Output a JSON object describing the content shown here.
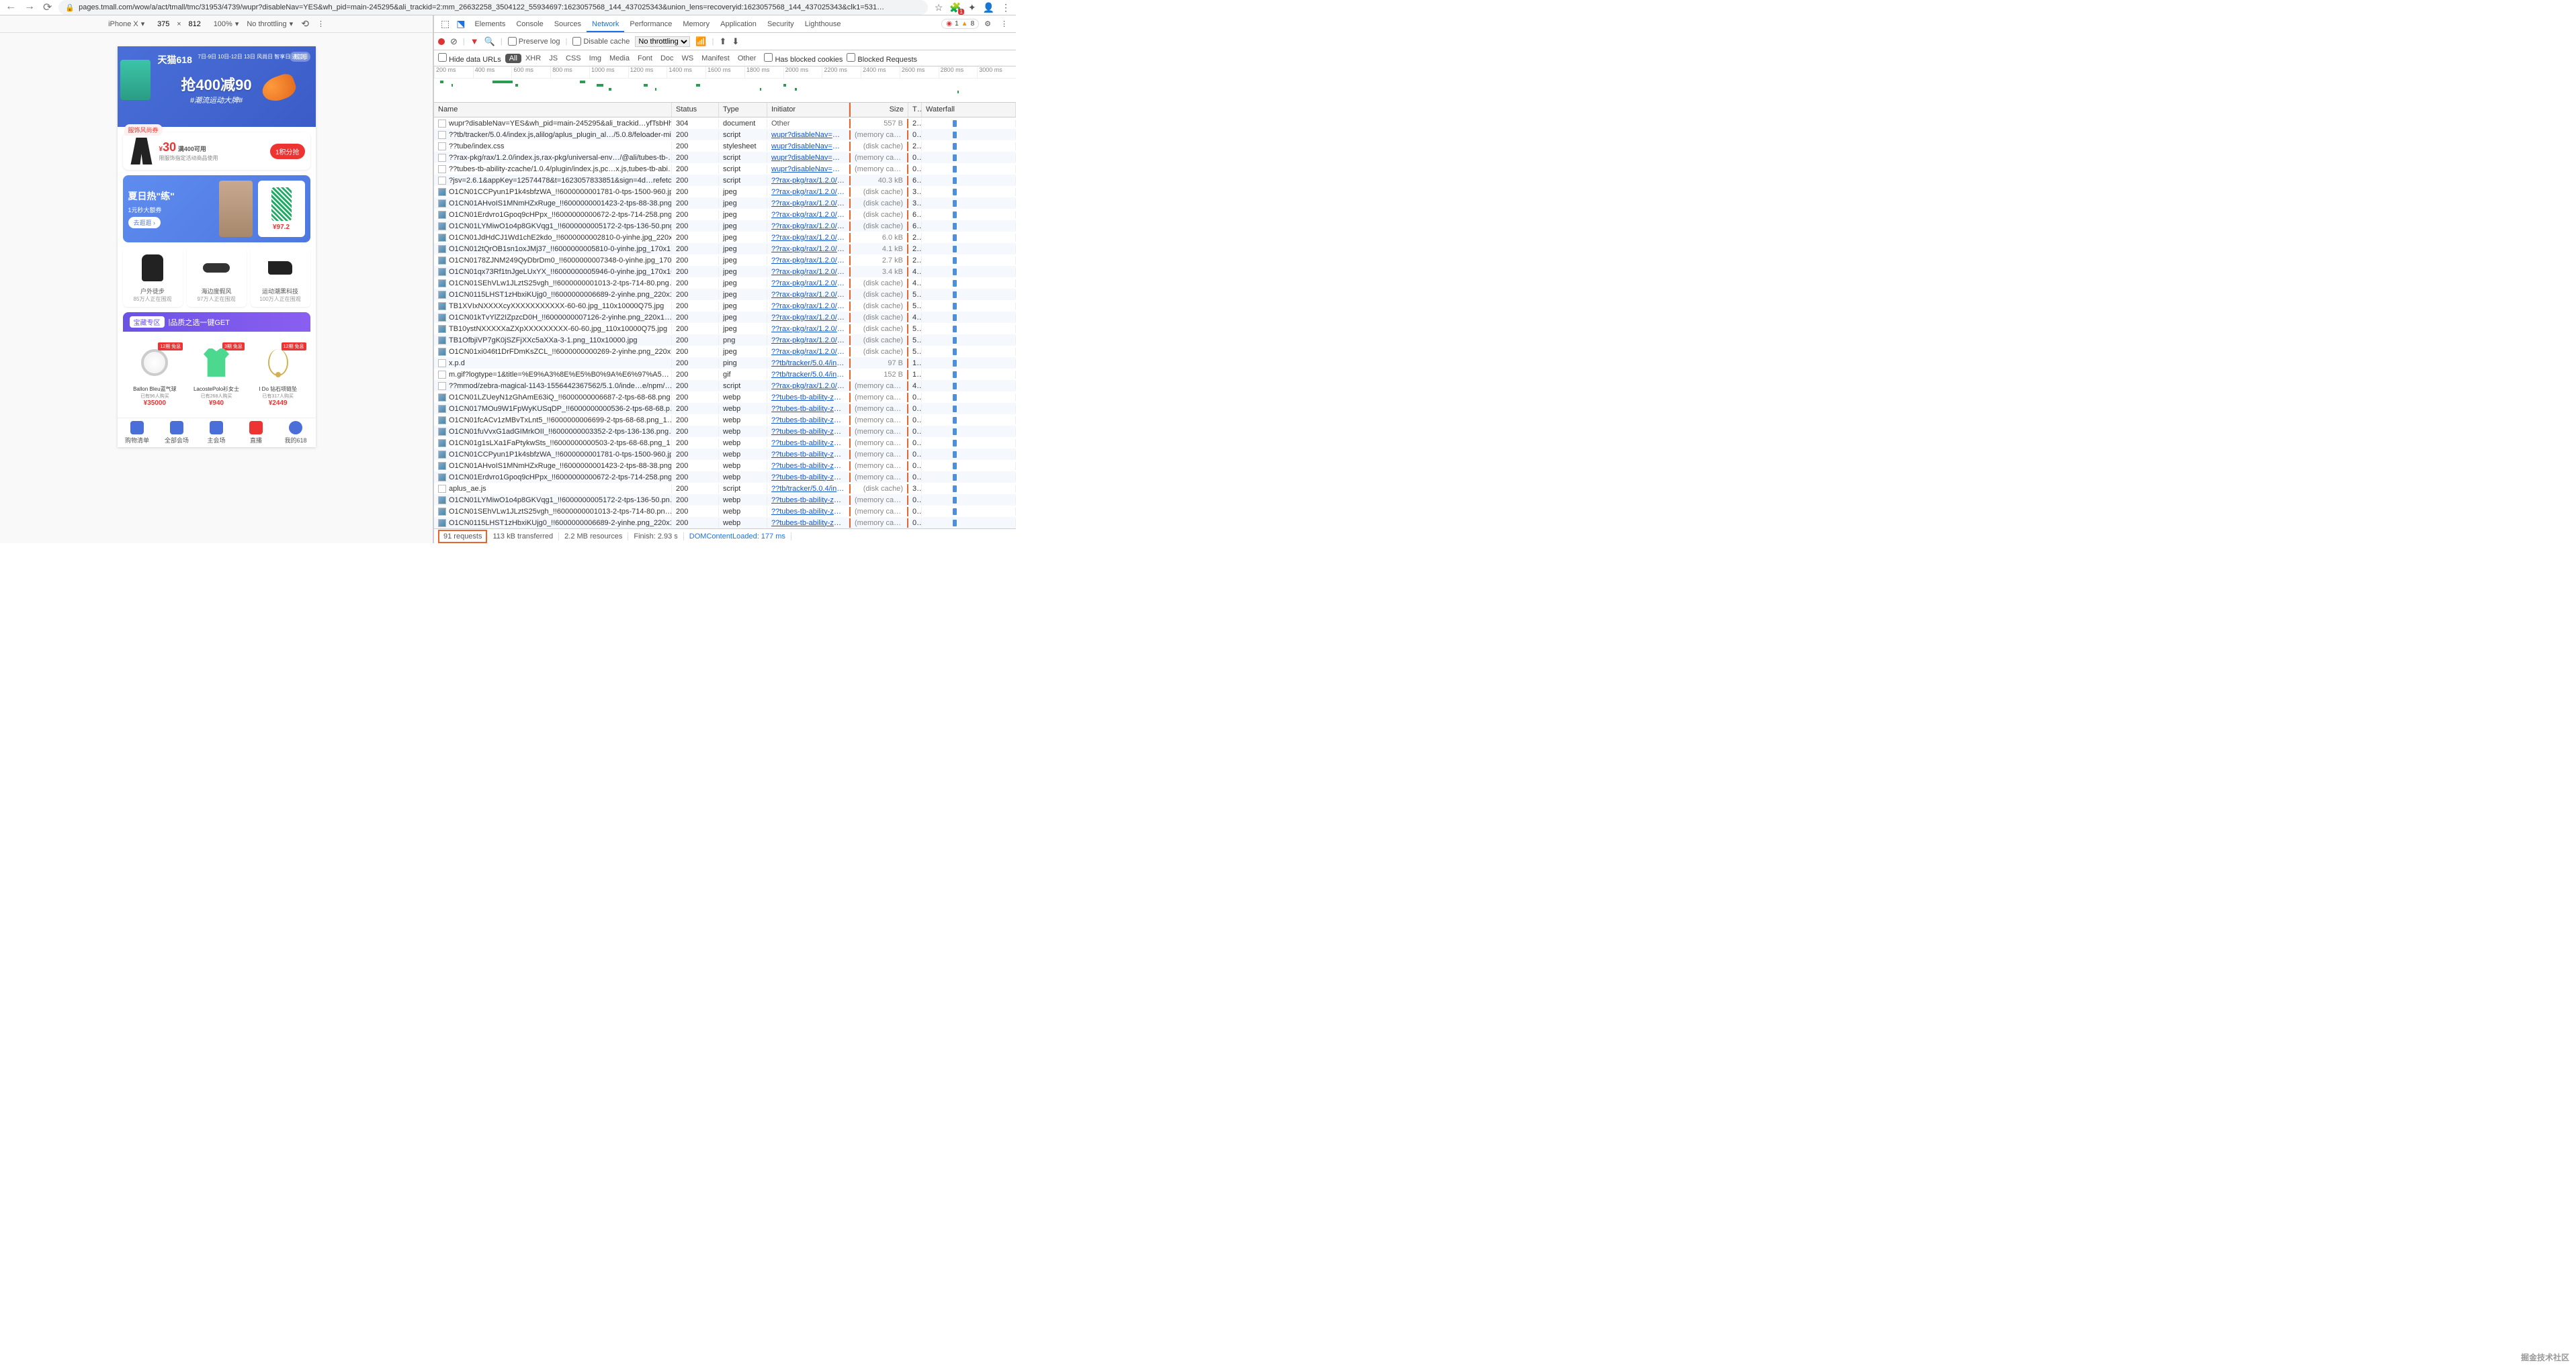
{
  "chrome": {
    "url": "pages.tmall.com/wow/a/act/tmall/tmc/31953/4739/wupr?disableNav=YES&wh_pid=main-245295&ali_trackid=2:mm_26632258_3504122_55934697:1623057568_144_437025343&union_lens=recoveryid:1623057568_144_437025343&clk1=531…",
    "ext_badge": "1"
  },
  "device_bar": {
    "device": "iPhone X",
    "width": "375",
    "height": "812",
    "zoom": "100%",
    "throttle": "No throttling"
  },
  "phone": {
    "banner": {
      "logo": "天猫618",
      "dates": "7日-9日 10日-12日 13日\n风尚日 智享日 进口日",
      "rule": "规则",
      "big": "抢400减90",
      "sub": "#潮流运动大牌#"
    },
    "coupon": {
      "tag": "服饰风尚券",
      "yen": "¥",
      "amt": "30",
      "cond": "满400可用",
      "desc": "限服饰指定活动商品使用",
      "btn": "1积分抢"
    },
    "summer": {
      "title": "夏日热\"练\"",
      "sub": "1元秒大额券",
      "go": "去逛逛 ›",
      "price": "¥97.2"
    },
    "cats": [
      {
        "t1": "户外徒步",
        "t2": "85万人正在围观"
      },
      {
        "t1": "海边度假风",
        "t2": "97万人正在围观"
      },
      {
        "t1": "运动潮黑科技",
        "t2": "100万人正在围观"
      }
    ],
    "treasure": {
      "pill": "宝藏专区",
      "text": "品质之选一键GET"
    },
    "products": [
      {
        "badge": "12期\n免息",
        "name": "Ballon Bleu蓝气球",
        "sold": "已有96人购买",
        "price": "¥35000"
      },
      {
        "badge": "3期\n免息",
        "name": "LacostePolo衫女士",
        "sold": "已有268人购买",
        "price": "¥940"
      },
      {
        "badge": "12期\n免息",
        "name": "I Do 钻石项链坠",
        "sold": "已有317人购买",
        "price": "¥2449"
      }
    ],
    "tabs": [
      "购物清单",
      "全部会场",
      "主会场",
      "直播",
      "我的618"
    ]
  },
  "devtools": {
    "tabs": [
      "Elements",
      "Console",
      "Sources",
      "Network",
      "Performance",
      "Memory",
      "Application",
      "Security",
      "Lighthouse"
    ],
    "active_tab": "Network",
    "errors": "1",
    "warnings": "8",
    "toolbar": {
      "preserve": "Preserve log",
      "disable_cache": "Disable cache",
      "throttle": "No throttling"
    },
    "filter": {
      "hide": "Hide data URLs",
      "types": [
        "All",
        "XHR",
        "JS",
        "CSS",
        "Img",
        "Media",
        "Font",
        "Doc",
        "WS",
        "Manifest",
        "Other"
      ],
      "blocked_cookies": "Has blocked cookies",
      "blocked_req": "Blocked Requests"
    },
    "ticks": [
      "200 ms",
      "400 ms",
      "600 ms",
      "800 ms",
      "1000 ms",
      "1200 ms",
      "1400 ms",
      "1600 ms",
      "1800 ms",
      "2000 ms",
      "2200 ms",
      "2400 ms",
      "2600 ms",
      "2800 ms",
      "3000 ms"
    ],
    "columns": {
      "name": "Name",
      "status": "Status",
      "type": "Type",
      "initiator": "Initiator",
      "size": "Size",
      "time": "T…",
      "waterfall": "Waterfall"
    },
    "rows": [
      {
        "ic": "doc",
        "name": "wupr?disableNav=YES&wh_pid=main-245295&ali_trackid…yfTsbHh…",
        "status": "304",
        "type": "document",
        "init": "Other",
        "initplain": true,
        "size": "557 B",
        "time": "2…"
      },
      {
        "ic": "doc",
        "name": "??tb/tracker/5.0.4/index.js,alilog/aplus_plugin_al…/5.0.8/feloader-mi…",
        "status": "200",
        "type": "script",
        "init": "wupr?disableNav=YES&w…",
        "size": "(memory cache)",
        "time": "0…"
      },
      {
        "ic": "doc",
        "name": "??tube/index.css",
        "status": "200",
        "type": "stylesheet",
        "init": "wupr?disableNav=YES&w…",
        "size": "(disk cache)",
        "time": "2…"
      },
      {
        "ic": "doc",
        "name": "??rax-pkg/rax/1.2.0/index.js,rax-pkg/universal-env…/@ali/tubes-tb-…",
        "status": "200",
        "type": "script",
        "init": "wupr?disableNav=YES&w…",
        "size": "(memory cache)",
        "time": "0…"
      },
      {
        "ic": "doc",
        "name": "??tubes-tb-ability-zcache/1.0.4/plugin/index.js,pc…x.js,tubes-tb-abi…",
        "status": "200",
        "type": "script",
        "init": "wupr?disableNav=YES&w…",
        "size": "(memory cache)",
        "time": "0…"
      },
      {
        "ic": "doc",
        "name": "?jsv=2.6.1&appKey=12574478&t=1623057833851&sign=4d…refetc…",
        "status": "200",
        "type": "script",
        "init": "??rax-pkg/rax/1.2.0/index…",
        "size": "40.3 kB",
        "time": "6…"
      },
      {
        "ic": "img",
        "name": "O1CN01CCPyun1P1k4sbfzWA_!!6000000001781-0-tps-1500-960.jp…",
        "status": "200",
        "type": "jpeg",
        "init": "??rax-pkg/rax/1.2.0/index…",
        "size": "(disk cache)",
        "time": "3…"
      },
      {
        "ic": "img",
        "name": "O1CN01AHvoIS1MNmHZxRuge_!!6000000001423-2-tps-88-38.png…",
        "status": "200",
        "type": "jpeg",
        "init": "??rax-pkg/rax/1.2.0/index…",
        "size": "(disk cache)",
        "time": "3…"
      },
      {
        "ic": "img",
        "name": "O1CN01Erdvro1Gpoq9cHPpx_!!6000000000672-2-tps-714-258.png…",
        "status": "200",
        "type": "jpeg",
        "init": "??rax-pkg/rax/1.2.0/index…",
        "size": "(disk cache)",
        "time": "6…"
      },
      {
        "ic": "img",
        "name": "O1CN01LYMiwO1o4p8GKVqg1_!!6000000005172-2-tps-136-50.png…",
        "status": "200",
        "type": "jpeg",
        "init": "??rax-pkg/rax/1.2.0/index…",
        "size": "(disk cache)",
        "time": "6…"
      },
      {
        "ic": "img",
        "name": "O1CN01JdHdCJ1Wd1chE2kdo_!!6000000002810-0-yinhe.jpg_220x…",
        "status": "200",
        "type": "jpeg",
        "init": "??rax-pkg/rax/1.2.0/index…",
        "size": "6.0 kB",
        "time": "2…"
      },
      {
        "ic": "img",
        "name": "O1CN012tQrOB1sn1oxJMj37_!!6000000005810-0-yinhe.jpg_170x1…",
        "status": "200",
        "type": "jpeg",
        "init": "??rax-pkg/rax/1.2.0/index…",
        "size": "4.1 kB",
        "time": "2…"
      },
      {
        "ic": "img",
        "name": "O1CN0178ZJNM249QyDbrDm0_!!6000000007348-0-yinhe.jpg_170x…",
        "status": "200",
        "type": "jpeg",
        "init": "??rax-pkg/rax/1.2.0/index…",
        "size": "2.7 kB",
        "time": "2…"
      },
      {
        "ic": "img",
        "name": "O1CN01qx73Rf1tnJgeLUxYX_!!6000000005946-0-yinhe.jpg_170x10…",
        "status": "200",
        "type": "jpeg",
        "init": "??rax-pkg/rax/1.2.0/index…",
        "size": "3.4 kB",
        "time": "4…"
      },
      {
        "ic": "img",
        "name": "O1CN01SEhVLw1JLztS25vgh_!!6000000001013-2-tps-714-80.png…",
        "status": "200",
        "type": "jpeg",
        "init": "??rax-pkg/rax/1.2.0/index…",
        "size": "(disk cache)",
        "time": "4…"
      },
      {
        "ic": "img",
        "name": "O1CN0115LHST1zHbxiKUjg0_!!6000000006689-2-yinhe.png_220x1…",
        "status": "200",
        "type": "jpeg",
        "init": "??rax-pkg/rax/1.2.0/index…",
        "size": "(disk cache)",
        "time": "5…"
      },
      {
        "ic": "img",
        "name": "TB1XVIxNXXXXcyXXXXXXXXXXX-60-60.jpg_110x10000Q75.jpg",
        "status": "200",
        "type": "jpeg",
        "init": "??rax-pkg/rax/1.2.0/index…",
        "size": "(disk cache)",
        "time": "5…"
      },
      {
        "ic": "img",
        "name": "O1CN01kTvYlZ2IZpzcD0H_!!6000000007126-2-yinhe.png_220x1…",
        "status": "200",
        "type": "jpeg",
        "init": "??rax-pkg/rax/1.2.0/index…",
        "size": "(disk cache)",
        "time": "4…"
      },
      {
        "ic": "img",
        "name": "TB10ystNXXXXXaZXpXXXXXXXXX-60-60.jpg_110x10000Q75.jpg",
        "status": "200",
        "type": "jpeg",
        "init": "??rax-pkg/rax/1.2.0/index…",
        "size": "(disk cache)",
        "time": "5…"
      },
      {
        "ic": "img",
        "name": "TB1OfbjiVP7gK0jSZFjXXc5aXXa-3-1.png_110x10000.jpg",
        "status": "200",
        "type": "png",
        "init": "??rax-pkg/rax/1.2.0/index…",
        "size": "(disk cache)",
        "time": "5…"
      },
      {
        "ic": "img",
        "name": "O1CN01xi046t1DrFDmKsZCL_!!6000000000269-2-yinhe.png_220x1…",
        "status": "200",
        "type": "jpeg",
        "init": "??rax-pkg/rax/1.2.0/index…",
        "size": "(disk cache)",
        "time": "5…"
      },
      {
        "ic": "doc",
        "name": "x.p.d",
        "status": "200",
        "type": "ping",
        "init": "??tb/tracker/5.0.4/index.js…",
        "size": "97 B",
        "time": "1…"
      },
      {
        "ic": "doc",
        "name": "m.gif?logtype=1&title=%E9%A3%8E%E5%B0%9A%E6%97%A5…",
        "status": "200",
        "type": "gif",
        "init": "??tb/tracker/5.0.4/index.js…",
        "size": "152 B",
        "time": "1…"
      },
      {
        "ic": "doc",
        "name": "??mmod/zebra-magical-1143-1556442367562/5.1.0/inde…e/npm/…",
        "status": "200",
        "type": "script",
        "init": "??rax-pkg/rax/1.2.0/index…",
        "size": "(memory cache)",
        "time": "4…"
      },
      {
        "ic": "img",
        "name": "O1CN01LZUeyN1zGhAmE63iQ_!!6000000006687-2-tps-68-68.png…",
        "status": "200",
        "type": "webp",
        "init": "??tubes-tb-ability-zcache/…",
        "size": "(memory cache)",
        "time": "0…"
      },
      {
        "ic": "img",
        "name": "O1CN017MOu9W1FpWyKUSqDP_!!6000000000536-2-tps-68-68.p…",
        "status": "200",
        "type": "webp",
        "init": "??tubes-tb-ability-zcache/…",
        "size": "(memory cache)",
        "time": "0…"
      },
      {
        "ic": "img",
        "name": "O1CN01fcACv1zMBvTxLnt5_!!6000000006699-2-tps-68-68.png_1…",
        "status": "200",
        "type": "webp",
        "init": "??tubes-tb-ability-zcache/…",
        "size": "(memory cache)",
        "time": "0…"
      },
      {
        "ic": "img",
        "name": "O1CN01fuVvxG1adGIMrkOII_!!6000000003352-2-tps-136-136.png…",
        "status": "200",
        "type": "webp",
        "init": "??tubes-tb-ability-zcache/…",
        "size": "(memory cache)",
        "time": "0…"
      },
      {
        "ic": "img",
        "name": "O1CN01g1sLXa1FaPtykwSts_!!6000000000503-2-tps-68-68.png_1…",
        "status": "200",
        "type": "webp",
        "init": "??tubes-tb-ability-zcache/…",
        "size": "(memory cache)",
        "time": "0…"
      },
      {
        "ic": "img",
        "name": "O1CN01CCPyun1P1k4sbfzWA_!!6000000001781-0-tps-1500-960.jp…",
        "status": "200",
        "type": "webp",
        "init": "??tubes-tb-ability-zcache/…",
        "size": "(memory cache)",
        "time": "0…"
      },
      {
        "ic": "img",
        "name": "O1CN01AHvoIS1MNmHZxRuge_!!6000000001423-2-tps-88-38.png…",
        "status": "200",
        "type": "webp",
        "init": "??tubes-tb-ability-zcache/…",
        "size": "(memory cache)",
        "time": "0…"
      },
      {
        "ic": "img",
        "name": "O1CN01Erdvro1Gpoq9cHPpx_!!6000000000672-2-tps-714-258.png…",
        "status": "200",
        "type": "webp",
        "init": "??tubes-tb-ability-zcache/…",
        "size": "(memory cache)",
        "time": "0…"
      },
      {
        "ic": "doc",
        "name": "aplus_ae.js",
        "status": "200",
        "type": "script",
        "init": "??tb/tracker/5.0.4/index.js…",
        "size": "(disk cache)",
        "time": "3…"
      },
      {
        "ic": "img",
        "name": "O1CN01LYMiwO1o4p8GKVqg1_!!6000000005172-2-tps-136-50.pn…",
        "status": "200",
        "type": "webp",
        "init": "??tubes-tb-ability-zcache/…",
        "size": "(memory cache)",
        "time": "0…"
      },
      {
        "ic": "img",
        "name": "O1CN01SEhVLw1JLztS25vgh_!!6000000001013-2-tps-714-80.pn…",
        "status": "200",
        "type": "webp",
        "init": "??tubes-tb-ability-zcache/…",
        "size": "(memory cache)",
        "time": "0…"
      },
      {
        "ic": "img",
        "name": "O1CN0115LHST1zHbxiKUjg0_!!6000000006689-2-yinhe.png_220x1…",
        "status": "200",
        "type": "webp",
        "init": "??tubes-tb-ability-zcache/…",
        "size": "(memory cache)",
        "time": "0…"
      }
    ],
    "status": {
      "requests": "91 requests",
      "transferred": "113 kB transferred",
      "resources": "2.2 MB resources",
      "finish": "Finish: 2.93 s",
      "dom": "DOMContentLoaded: 177 ms"
    }
  },
  "watermark": "掘金技术社区"
}
